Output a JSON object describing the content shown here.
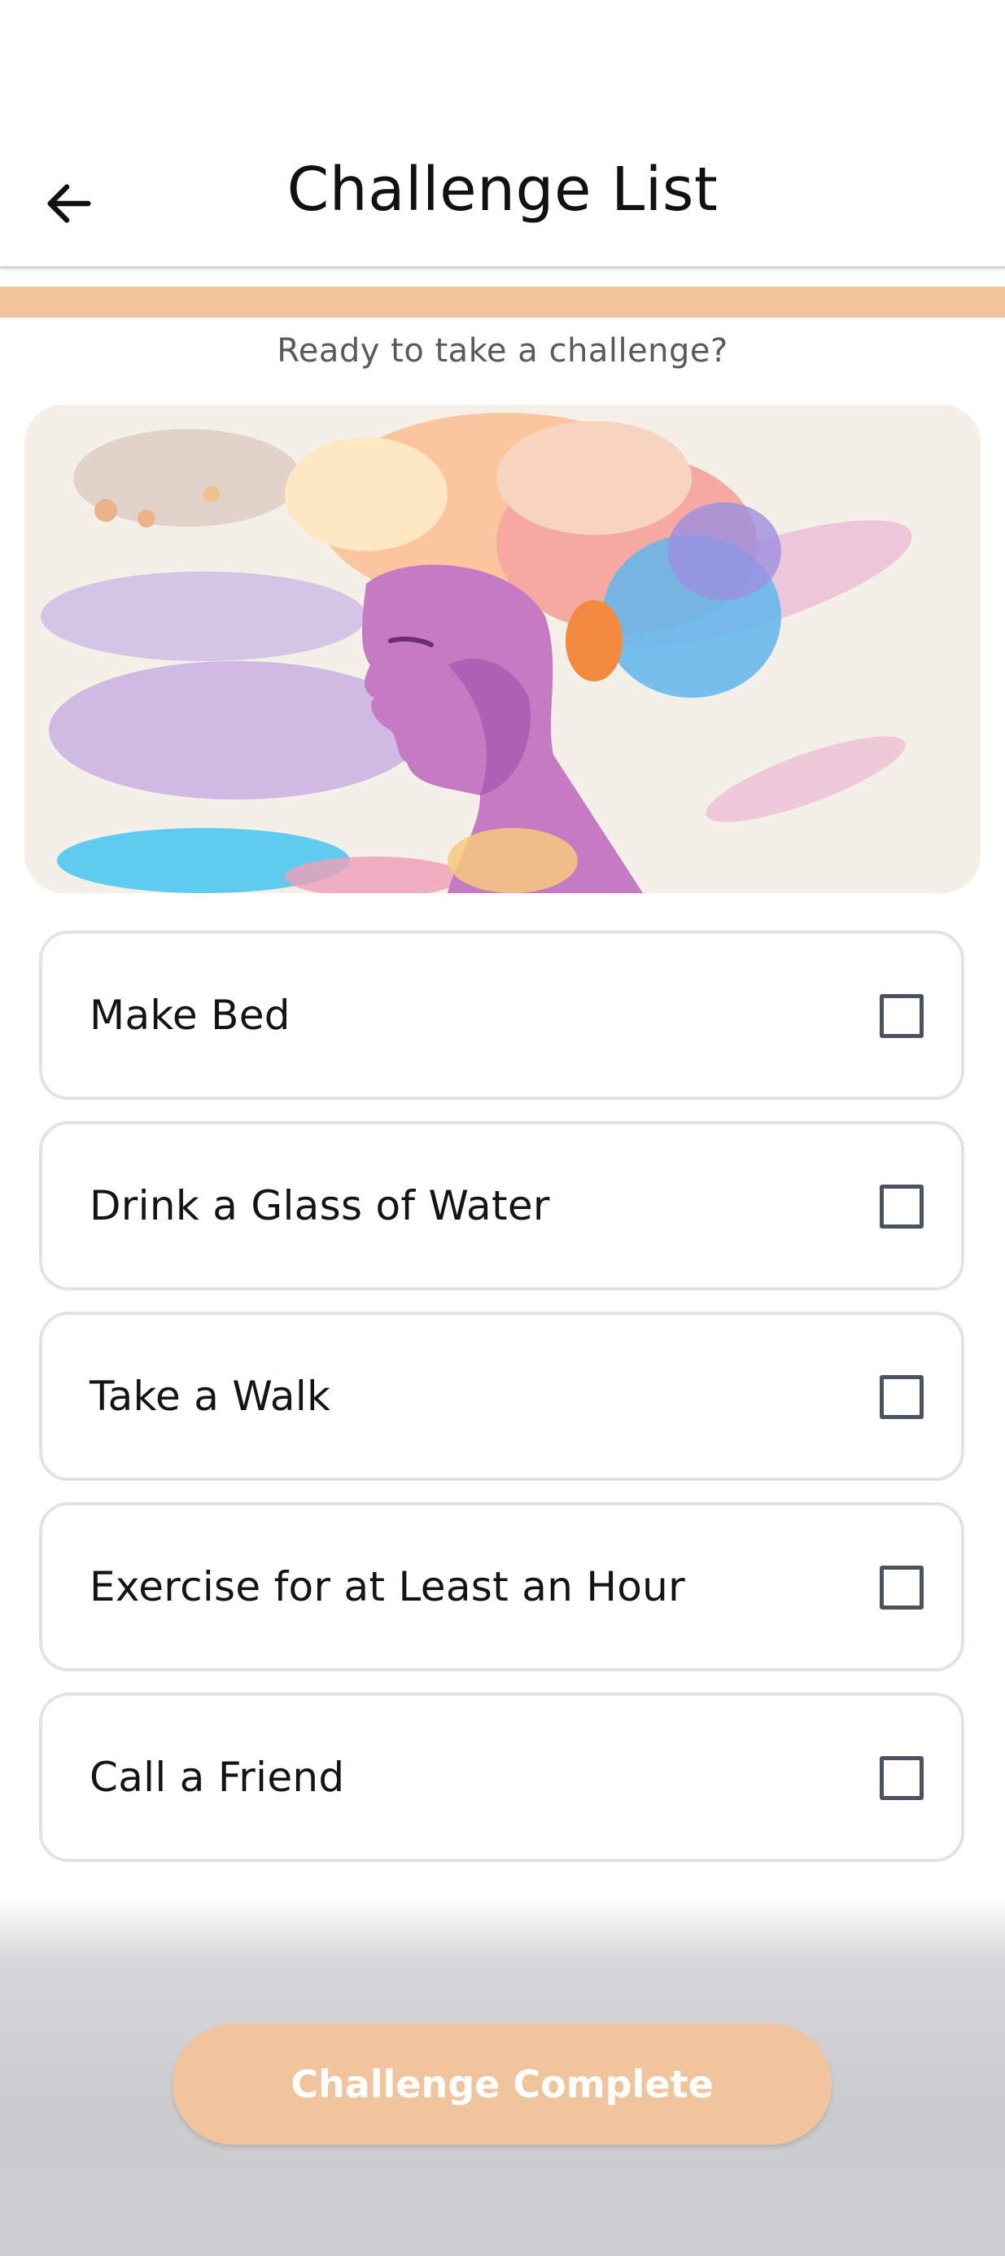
{
  "header": {
    "title": "Challenge List",
    "back_icon": "arrow-left-icon"
  },
  "progress": {
    "completed_fraction": 1.0,
    "color": "#f2c49b"
  },
  "subtitle": "Ready to take a challenge?",
  "hero_image": {
    "subject": "watercolor-portrait-illustration"
  },
  "challenges": [
    {
      "label": "Make Bed",
      "checked": false
    },
    {
      "label": "Drink a Glass of Water",
      "checked": false
    },
    {
      "label": "Take a Walk",
      "checked": false
    },
    {
      "label": "Exercise for at Least an Hour",
      "checked": false
    },
    {
      "label": "Call a Friend",
      "checked": false
    }
  ],
  "footer": {
    "complete_button_label": "Challenge Complete",
    "button_color": "#f0c59d"
  }
}
